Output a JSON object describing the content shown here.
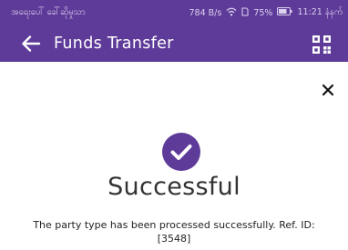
{
  "status_bar": {
    "carrier": "အရေးပေါ် ခေါ်ဆိုမှုသာ",
    "speed": "784 B/s",
    "battery": "75%",
    "time": "11:21 နံနက်",
    "icons": [
      "wifi-icon",
      "sim-icon",
      "battery-icon"
    ]
  },
  "app_bar": {
    "title": "Funds Transfer",
    "back_icon": "arrow-left-icon",
    "action_icon": "qr-code-icon",
    "background": "#5e3b99"
  },
  "result": {
    "close_icon": "close-icon",
    "status_icon": "check-circle-icon",
    "status_color": "#5e3b99",
    "title": "Successful",
    "message": "The party type has been processed successfully. Ref. ID: [3548]"
  }
}
